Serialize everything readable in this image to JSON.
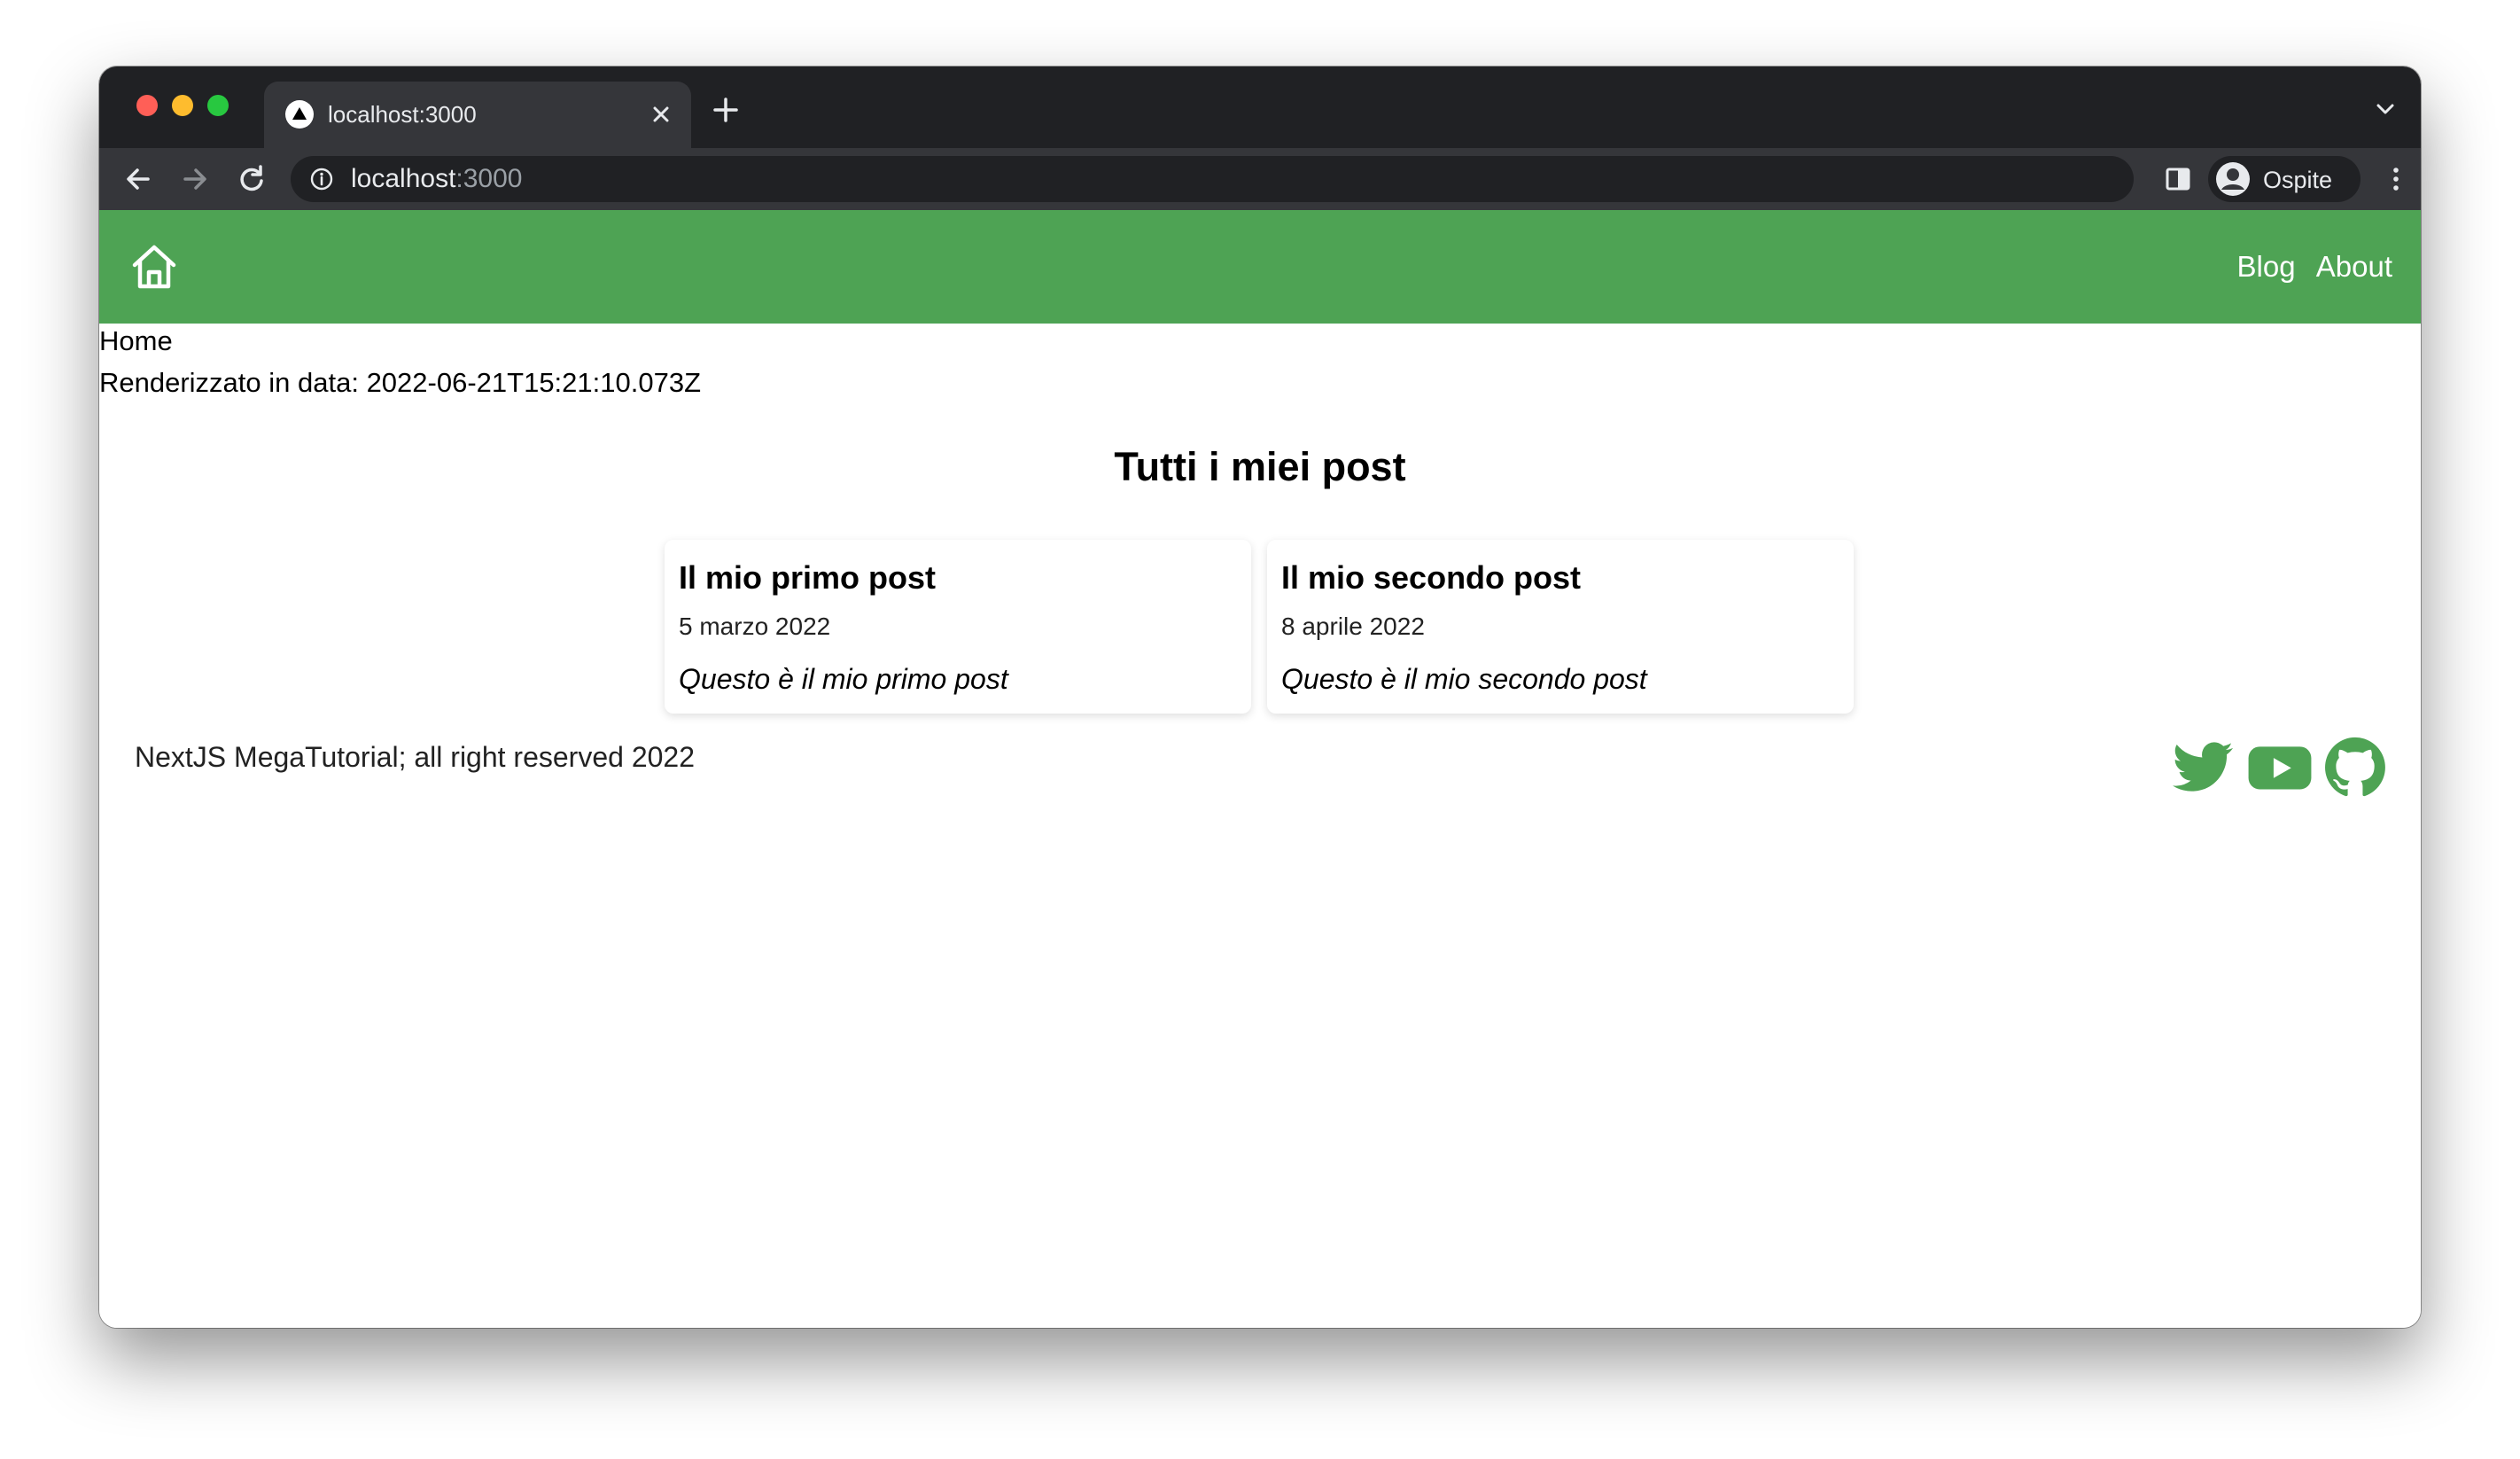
{
  "browser": {
    "tab_title": "localhost:3000",
    "url_host": "localhost",
    "url_port": ":3000",
    "profile_name": "Ospite"
  },
  "navbar": {
    "links": [
      "Blog",
      "About"
    ],
    "color": "#4ea354"
  },
  "page": {
    "route_label": "Home",
    "render_info": "Renderizzato in data: 2022-06-21T15:21:10.073Z",
    "title": "Tutti i miei post"
  },
  "posts": [
    {
      "title": "Il mio primo post",
      "date": "5 marzo 2022",
      "excerpt": "Questo è il mio primo post"
    },
    {
      "title": "Il mio secondo post",
      "date": "8 aprile 2022",
      "excerpt": "Questo è il mio secondo post"
    }
  ],
  "footer": {
    "text": "NextJS MegaTutorial; all right reserved 2022",
    "social_icons": [
      "twitter-icon",
      "youtube-icon",
      "github-icon"
    ],
    "icon_color": "#4ea354"
  }
}
